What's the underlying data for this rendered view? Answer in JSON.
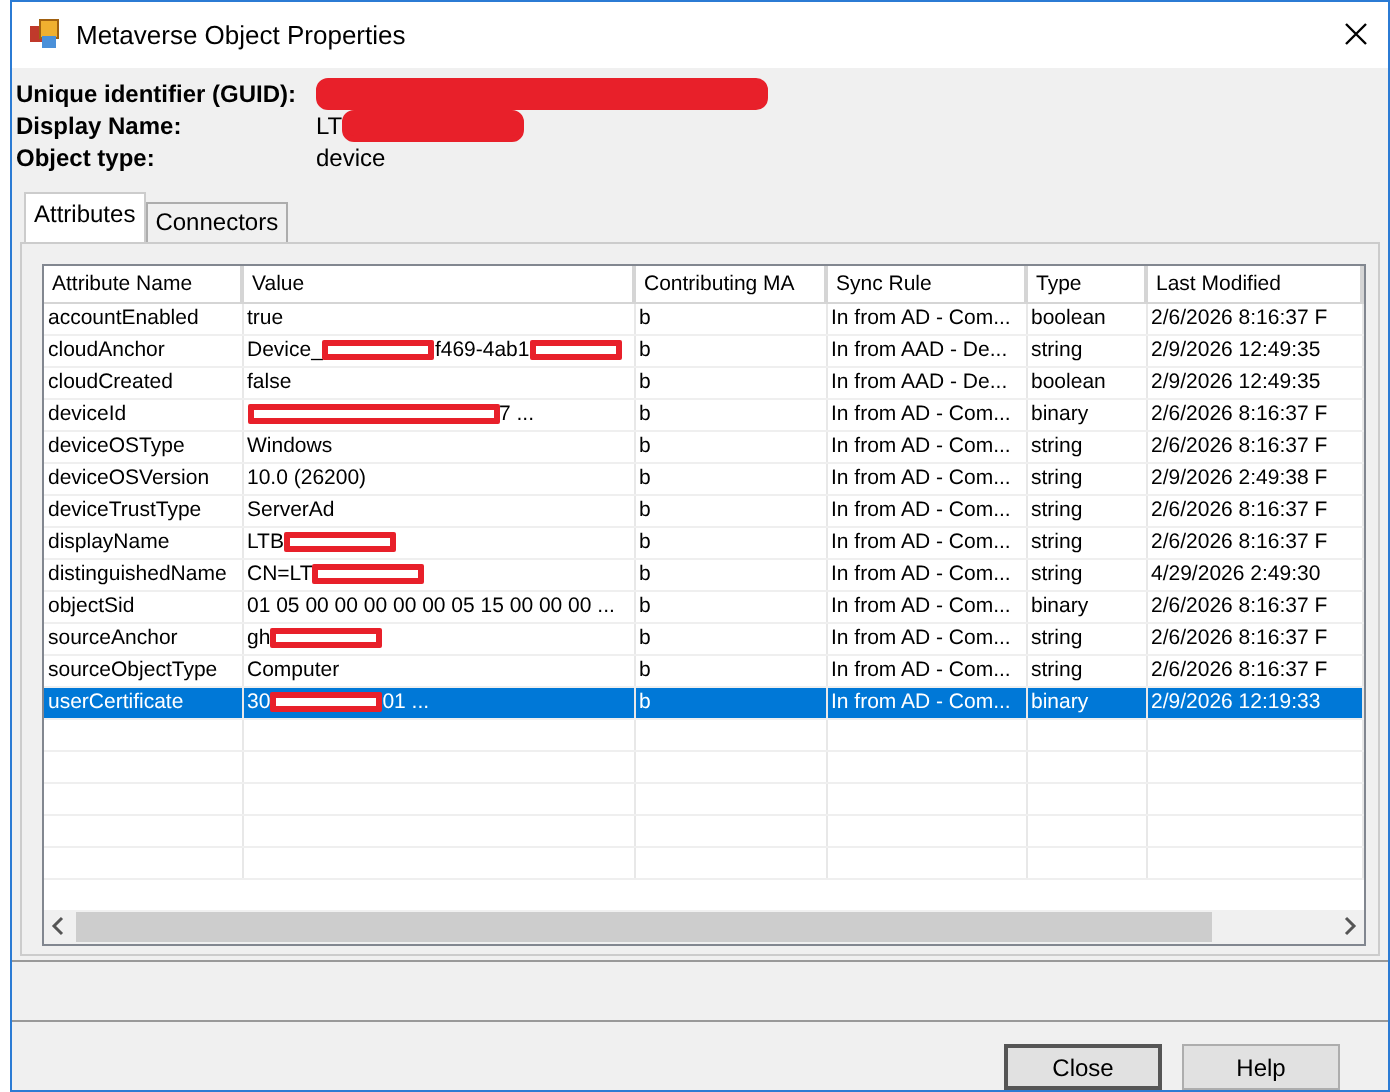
{
  "window": {
    "title": "Metaverse Object Properties"
  },
  "summary": [
    {
      "label": "Unique identifier (GUID):",
      "value": [
        {
          "kind": "redaction"
        }
      ]
    },
    {
      "label": "Display Name:",
      "value": [
        {
          "kind": "text",
          "text": "LT"
        },
        {
          "kind": "redaction"
        }
      ]
    },
    {
      "label": "Object type:",
      "value": [
        {
          "kind": "text",
          "text": "device"
        }
      ]
    }
  ],
  "tabs": [
    {
      "label": "Attributes",
      "selected": true
    },
    {
      "label": "Connectors",
      "selected": false
    }
  ],
  "table": {
    "columns": [
      "Attribute Name",
      "Value",
      "Contributing MA",
      "Sync Rule",
      "Type",
      "Last Modified"
    ],
    "rows": [
      {
        "name": "accountEnabled",
        "value": [
          {
            "kind": "text",
            "text": "true"
          }
        ],
        "ma": "b",
        "rule": "In from AD - Com...",
        "type": "boolean",
        "modified": "2/6/2026 8:16:37 F",
        "selected": false
      },
      {
        "name": "cloudAnchor",
        "value": [
          {
            "kind": "text",
            "text": "Device_"
          },
          {
            "kind": "redaction"
          },
          {
            "kind": "text",
            "text": "f469-4ab1"
          },
          {
            "kind": "redaction"
          }
        ],
        "ma": "b",
        "rule": "In from AAD - De...",
        "type": "string",
        "modified": "2/9/2026 12:49:35",
        "selected": false
      },
      {
        "name": "cloudCreated",
        "value": [
          {
            "kind": "text",
            "text": "false"
          }
        ],
        "ma": "b",
        "rule": "In from AAD - De...",
        "type": "boolean",
        "modified": "2/9/2026 12:49:35",
        "selected": false
      },
      {
        "name": "deviceId",
        "value": [
          {
            "kind": "redaction"
          },
          {
            "kind": "text",
            "text": "7 ..."
          }
        ],
        "ma": "b",
        "rule": "In from AD - Com...",
        "type": "binary",
        "modified": "2/6/2026 8:16:37 F",
        "selected": false
      },
      {
        "name": "deviceOSType",
        "value": [
          {
            "kind": "text",
            "text": "Windows"
          }
        ],
        "ma": "b",
        "rule": "In from AD - Com...",
        "type": "string",
        "modified": "2/6/2026 8:16:37 F",
        "selected": false
      },
      {
        "name": "deviceOSVersion",
        "value": [
          {
            "kind": "text",
            "text": "10.0 (26200)"
          }
        ],
        "ma": "b",
        "rule": "In from AD - Com...",
        "type": "string",
        "modified": "2/9/2026 2:49:38 F",
        "selected": false
      },
      {
        "name": "deviceTrustType",
        "value": [
          {
            "kind": "text",
            "text": "ServerAd"
          }
        ],
        "ma": "b",
        "rule": "In from AD - Com...",
        "type": "string",
        "modified": "2/6/2026 8:16:37 F",
        "selected": false
      },
      {
        "name": "displayName",
        "value": [
          {
            "kind": "text",
            "text": "LTB"
          },
          {
            "kind": "redaction"
          }
        ],
        "ma": "b",
        "rule": "In from AD - Com...",
        "type": "string",
        "modified": "2/6/2026 8:16:37 F",
        "selected": false
      },
      {
        "name": "distinguishedName",
        "value": [
          {
            "kind": "text",
            "text": "CN=LT"
          },
          {
            "kind": "redaction"
          }
        ],
        "ma": "b",
        "rule": "In from AD - Com...",
        "type": "string",
        "modified": "4/29/2026 2:49:30",
        "selected": false
      },
      {
        "name": "objectSid",
        "value": [
          {
            "kind": "text",
            "text": "01 05 00 00 00 00 00 05 15 00 00 00 ..."
          }
        ],
        "ma": "b",
        "rule": "In from AD - Com...",
        "type": "binary",
        "modified": "2/6/2026 8:16:37 F",
        "selected": false
      },
      {
        "name": "sourceAnchor",
        "value": [
          {
            "kind": "text",
            "text": "gh"
          },
          {
            "kind": "redaction"
          }
        ],
        "ma": "b",
        "rule": "In from AD - Com...",
        "type": "string",
        "modified": "2/6/2026 8:16:37 F",
        "selected": false
      },
      {
        "name": "sourceObjectType",
        "value": [
          {
            "kind": "text",
            "text": "Computer"
          }
        ],
        "ma": "b",
        "rule": "In from AD - Com...",
        "type": "string",
        "modified": "2/6/2026 8:16:37 F",
        "selected": false
      },
      {
        "name": "userCertificate",
        "value": [
          {
            "kind": "text",
            "text": "30"
          },
          {
            "kind": "redaction"
          },
          {
            "kind": "text",
            "text": "01 ..."
          }
        ],
        "ma": "b",
        "rule": "In from AD - Com...",
        "type": "binary",
        "modified": "2/9/2026 12:19:33",
        "selected": true
      }
    ]
  },
  "buttons": [
    "Close",
    "Help"
  ]
}
